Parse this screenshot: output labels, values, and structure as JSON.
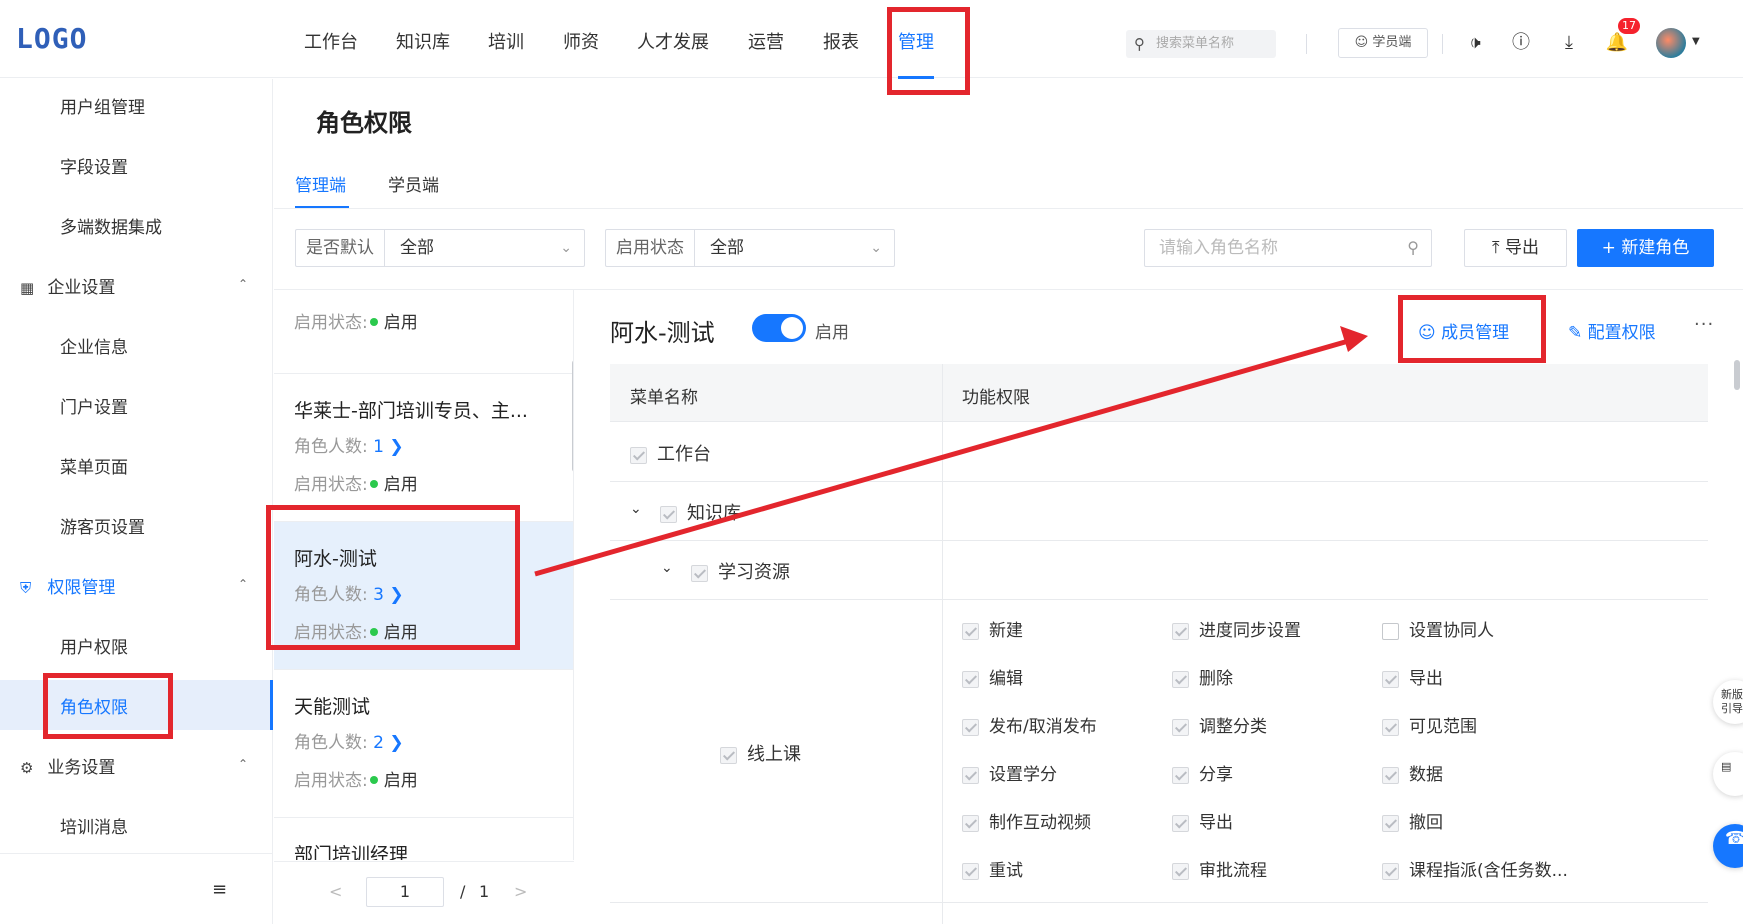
{
  "logo": "LOGO",
  "nav": {
    "items": [
      "工作台",
      "知识库",
      "培训",
      "师资",
      "人才发展",
      "运营",
      "报表",
      "管理"
    ],
    "active_index": 7
  },
  "header": {
    "search_placeholder": "搜索菜单名称",
    "student_button": "学员端",
    "notification_count": "17",
    "icons": [
      "megaphone-icon",
      "help-icon",
      "download-icon",
      "bell-icon",
      "avatar",
      "caret-down-icon"
    ]
  },
  "sidebar": {
    "items": [
      {
        "type": "sub",
        "label": "用户组管理"
      },
      {
        "type": "sub",
        "label": "字段设置"
      },
      {
        "type": "sub",
        "label": "多端数据集成"
      },
      {
        "type": "group",
        "label": "企业设置",
        "icon": "building-icon"
      },
      {
        "type": "sub",
        "label": "企业信息"
      },
      {
        "type": "sub",
        "label": "门户设置"
      },
      {
        "type": "sub",
        "label": "菜单页面"
      },
      {
        "type": "sub",
        "label": "游客页设置"
      },
      {
        "type": "group",
        "label": "权限管理",
        "icon": "shield-icon",
        "active": true
      },
      {
        "type": "sub",
        "label": "用户权限"
      },
      {
        "type": "sub",
        "label": "角色权限",
        "active": true
      },
      {
        "type": "group",
        "label": "业务设置",
        "icon": "business-icon"
      },
      {
        "type": "sub",
        "label": "培训消息"
      }
    ]
  },
  "page": {
    "title": "角色权限",
    "tabs": [
      "管理端",
      "学员端"
    ],
    "active_tab": 0
  },
  "filters": {
    "default_label": "是否默认",
    "default_value": "全部",
    "status_label": "启用状态",
    "status_value": "全部",
    "role_search_placeholder": "请输入角色名称",
    "export_label": "导出",
    "new_role_label": "新建角色"
  },
  "roles": {
    "count_label": "角色人数:",
    "status_label": "启用状态:",
    "partial_top_status": "启用",
    "items": [
      {
        "name": "华莱士-部门培训专员、主...",
        "count": "1",
        "status": "启用"
      },
      {
        "name": "阿水-测试",
        "count": "3",
        "status": "启用",
        "selected": true
      },
      {
        "name": "天能测试",
        "count": "2",
        "status": "启用"
      },
      {
        "name": "部门培训经理",
        "count": "",
        "status": ""
      }
    ]
  },
  "pager": {
    "current": "1",
    "separator": "/",
    "total": "1"
  },
  "detail": {
    "title": "阿水-测试",
    "toggle_label": "启用",
    "enabled": true,
    "member_button": "成员管理",
    "config_button": "配置权限",
    "more": "···",
    "table_headers": [
      "菜单名称",
      "功能权限"
    ],
    "menu_rows": [
      {
        "label": "工作台",
        "checked": true
      },
      {
        "label": "知识库",
        "checked": true,
        "expandable": true
      },
      {
        "label": "学习资源",
        "checked": true,
        "expandable": true
      },
      {
        "label": "线上课",
        "checked": true
      }
    ],
    "permissions": [
      {
        "label": "新建",
        "checked": true
      },
      {
        "label": "进度同步设置",
        "checked": true
      },
      {
        "label": "设置协同人",
        "checked": false
      },
      {
        "label": "编辑",
        "checked": true
      },
      {
        "label": "删除",
        "checked": true
      },
      {
        "label": "导出",
        "checked": true
      },
      {
        "label": "发布/取消发布",
        "checked": true
      },
      {
        "label": "调整分类",
        "checked": true
      },
      {
        "label": "可见范围",
        "checked": true
      },
      {
        "label": "设置学分",
        "checked": true
      },
      {
        "label": "分享",
        "checked": true
      },
      {
        "label": "数据",
        "checked": true
      },
      {
        "label": "制作互动视频",
        "checked": true
      },
      {
        "label": "导出",
        "checked": true
      },
      {
        "label": "撤回",
        "checked": true
      },
      {
        "label": "重试",
        "checked": true
      },
      {
        "label": "审批流程",
        "checked": true
      },
      {
        "label": "课程指派(含任务数...",
        "checked": true
      }
    ]
  },
  "floating": {
    "top_text": "新版\n引导",
    "icons": [
      "feedback-icon",
      "headset-icon"
    ]
  },
  "annotations": {
    "color": "#e3262d"
  }
}
